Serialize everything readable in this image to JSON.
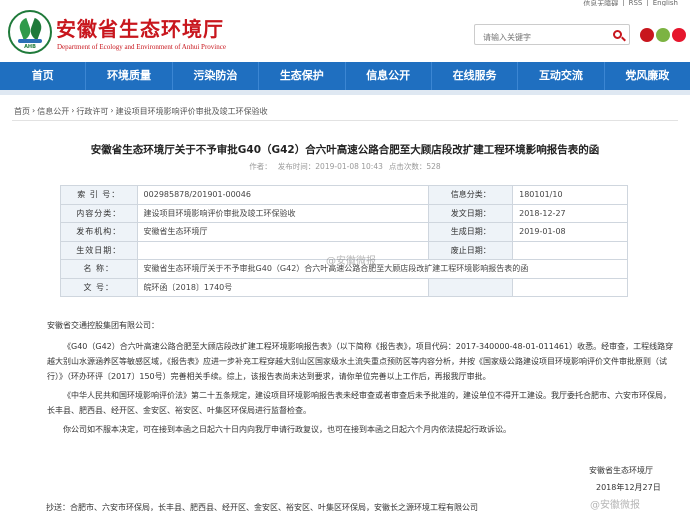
{
  "topbar": {
    "links": [
      "信息无障碍",
      "|",
      "RSS",
      "|",
      "English"
    ]
  },
  "header": {
    "title": "安徽省生态环境厅",
    "subtitle": "Department of Ecology and Environment of Anhui Province",
    "search_placeholder": "请输入关键字",
    "logo_code": "AHB"
  },
  "nav": [
    "首页",
    "环境质量",
    "污染防治",
    "生态保护",
    "信息公开",
    "在线服务",
    "互动交流",
    "党风廉政"
  ],
  "breadcrumb": [
    "首页",
    "信息公开",
    "行政许可",
    "建设项目环境影响评价审批及竣工环保验收"
  ],
  "article": {
    "title": "安徽省生态环境厅关于不予审批G40（G42）合六叶高速公路合肥至大顾店段改扩建工程环境影响报告表的函",
    "meta_author": "作者：",
    "meta_date": "发布时间：2019-01-08 10:43",
    "meta_views": "点击次数：528"
  },
  "info_table": {
    "rows": [
      {
        "k1": "索 引 号：",
        "v1": "002985878/201901-00046",
        "k2": "信息分类：",
        "v2": "180101/10"
      },
      {
        "k1": "内容分类：",
        "v1": "建设项目环境影响评价审批及竣工环保验收",
        "k2": "发文日期：",
        "v2": "2018-12-27"
      },
      {
        "k1": "发布机构：",
        "v1": "安徽省生态环境厅",
        "k2": "生成日期：",
        "v2": "2019-01-08"
      },
      {
        "k1": "生效日期：",
        "v1": "",
        "k2": "废止日期：",
        "v2": ""
      }
    ],
    "name_label": "名 称：",
    "name_value": "安徽省生态环境厅关于不予审批G40（G42）合六叶高速公路合肥至大顾店段改扩建工程环境影响报告表的函",
    "doc_no_label": "文 号：",
    "doc_no_value": "皖环函〔2018〕1740号"
  },
  "body": {
    "salutation": "安徽省交通控股集团有限公司：",
    "p1": "《G40（G42）合六叶高速公路合肥至大顾店段改扩建工程环境影响报告表》（以下简称《报告表》，项目代码：2017-340000-48-01-011461）收悉。经审查，工程线路穿越大别山水源涵养区等敏感区域，《报告表》应进一步补充工程穿越大别山区国家级水土流失重点预防区等内容分析，并按《国家级公路建设项目环境影响评价文件审批原则（试行）》（环办环评〔2017〕150号）完善相关手续。综上，该报告表尚未达到要求，请你单位完善以上工作后，再报我厅审批。",
    "p2": "《中华人民共和国环境影响评价法》第二十五条规定，建设项目环境影响报告表未经审查或者审查后未予批准的，建设单位不得开工建设。我厅委托合肥市、六安市环保局，长丰县、肥西县、经开区、金安区、裕安区、叶集区环保局进行监督检查。",
    "p3": "你公司如不服本决定，可在接到本函之日起六十日内向我厅申请行政复议，也可在接到本函之日起六个月内依法提起行政诉讼。",
    "signature": "安徽省生态环境厅",
    "sign_date": "2018年12月27日",
    "cc": "抄送：合肥市、六安市环保局，长丰县、肥西县、经开区、金安区、裕安区、叶集区环保局，安徽长之源环境工程有限公司"
  },
  "watermark": "@安徽微报",
  "watermark2": "@安徽微报"
}
